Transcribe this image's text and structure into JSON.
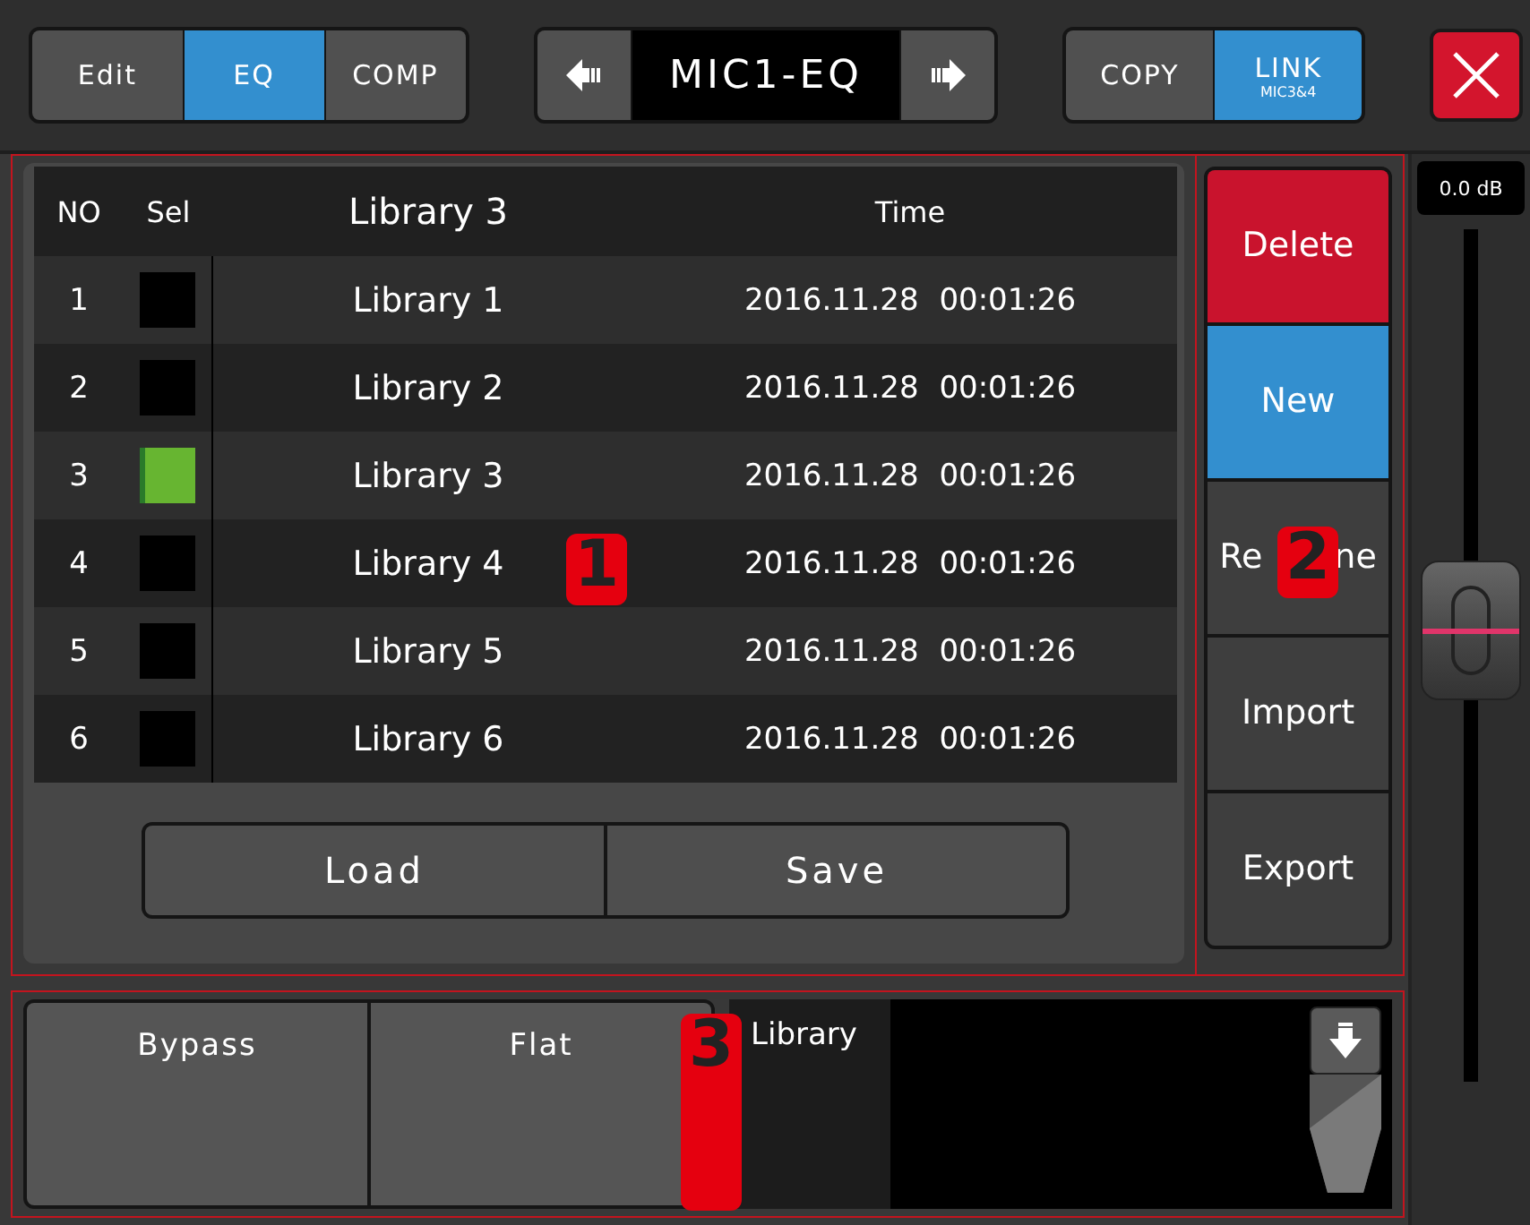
{
  "mode_tabs": [
    {
      "label": "Edit",
      "selected": false
    },
    {
      "label": "EQ",
      "selected": true
    },
    {
      "label": "COMP",
      "selected": false
    }
  ],
  "title": "MIC1-EQ",
  "link_buttons": [
    {
      "label": "COPY",
      "selected": false
    },
    {
      "label": "LINK",
      "sublabel": "MIC3&4",
      "selected": true
    }
  ],
  "library_table": {
    "columns": [
      "NO",
      "Sel",
      "Library 3",
      "Time"
    ],
    "rows": [
      {
        "no": "1",
        "name": "Library 1",
        "time": "2016.11.28 00:01:26",
        "selected": false
      },
      {
        "no": "2",
        "name": "Library 2",
        "time": "2016.11.28 00:01:26",
        "selected": false
      },
      {
        "no": "3",
        "name": "Library 3",
        "time": "2016.11.28 00:01:26",
        "selected": true
      },
      {
        "no": "4",
        "name": "Library 4",
        "time": "2016.11.28 00:01:26",
        "selected": false
      },
      {
        "no": "5",
        "name": "Library 5",
        "time": "2016.11.28 00:01:26",
        "selected": false
      },
      {
        "no": "6",
        "name": "Library 6",
        "time": "2016.11.28 00:01:26",
        "selected": false
      }
    ]
  },
  "table_buttons": [
    "Load",
    "Save"
  ],
  "actions": [
    {
      "label": "Delete",
      "kind": "danger"
    },
    {
      "label": "New",
      "kind": "primary"
    },
    {
      "parts": [
        "Re",
        "ne"
      ],
      "kind": "normal"
    },
    {
      "label": "Import",
      "kind": "normal"
    },
    {
      "label": "Export",
      "kind": "normal"
    }
  ],
  "fader": {
    "reading": "0.0 dB",
    "level": 0.53
  },
  "bottom_buttons": [
    "Bypass",
    "Flat"
  ],
  "library_field": {
    "label": "Library"
  },
  "callouts": [
    "1",
    "2",
    "3"
  ]
}
